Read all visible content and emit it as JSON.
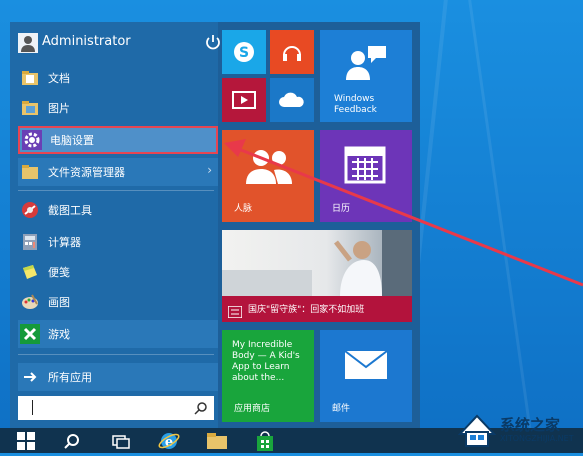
{
  "start_menu": {
    "user": {
      "name": "Administrator"
    },
    "items": [
      {
        "label": "文档",
        "icon": "folder-docs-icon"
      },
      {
        "label": "图片",
        "icon": "folder-pictures-icon"
      },
      {
        "label": "电脑设置",
        "icon": "gear-icon"
      },
      {
        "label": "文件资源管理器",
        "icon": "folder-explorer-icon",
        "arrow": "›"
      },
      {
        "label": "截图工具",
        "icon": "snipping-tool-icon"
      },
      {
        "label": "计算器",
        "icon": "calculator-icon"
      },
      {
        "label": "便笺",
        "icon": "sticky-notes-icon"
      },
      {
        "label": "画图",
        "icon": "paint-palette-icon"
      },
      {
        "label": "游戏",
        "icon": "xbox-games-icon"
      },
      {
        "label": "所有应用",
        "icon": "arrow-right-icon"
      }
    ],
    "search": {
      "placeholder": ""
    }
  },
  "tiles": {
    "skype": {
      "icon": "skype-icon"
    },
    "music": {
      "icon": "headphones-icon"
    },
    "video": {
      "icon": "video-play-icon"
    },
    "onedrive": {
      "icon": "cloud-icon"
    },
    "feedback": {
      "label": "Windows\nFeedback"
    },
    "people": {
      "label": "人脉"
    },
    "calendar": {
      "label": "日历"
    },
    "news": {
      "label": "国庆\"留守族\"：回家不如加班"
    },
    "store": {
      "text": "My Incredible Body — A Kid's App to Learn about the...",
      "label": "应用商店"
    },
    "mail": {
      "label": "邮件"
    }
  },
  "watermark": {
    "title": "系统之家",
    "subtitle": "XITONGZHIJIA.NET"
  },
  "colors": {
    "skype": "#1aa7e8",
    "music": "#e84a23",
    "video": "#b5173b",
    "onedrive": "#1b78c8",
    "feedback": "#1d7fd6",
    "people": "#e1532b",
    "calendar": "#6d35b8",
    "news_bar": "#b3133c",
    "store": "#19a53c",
    "mail": "#1c78d0",
    "highlight_border": "#e64552"
  }
}
